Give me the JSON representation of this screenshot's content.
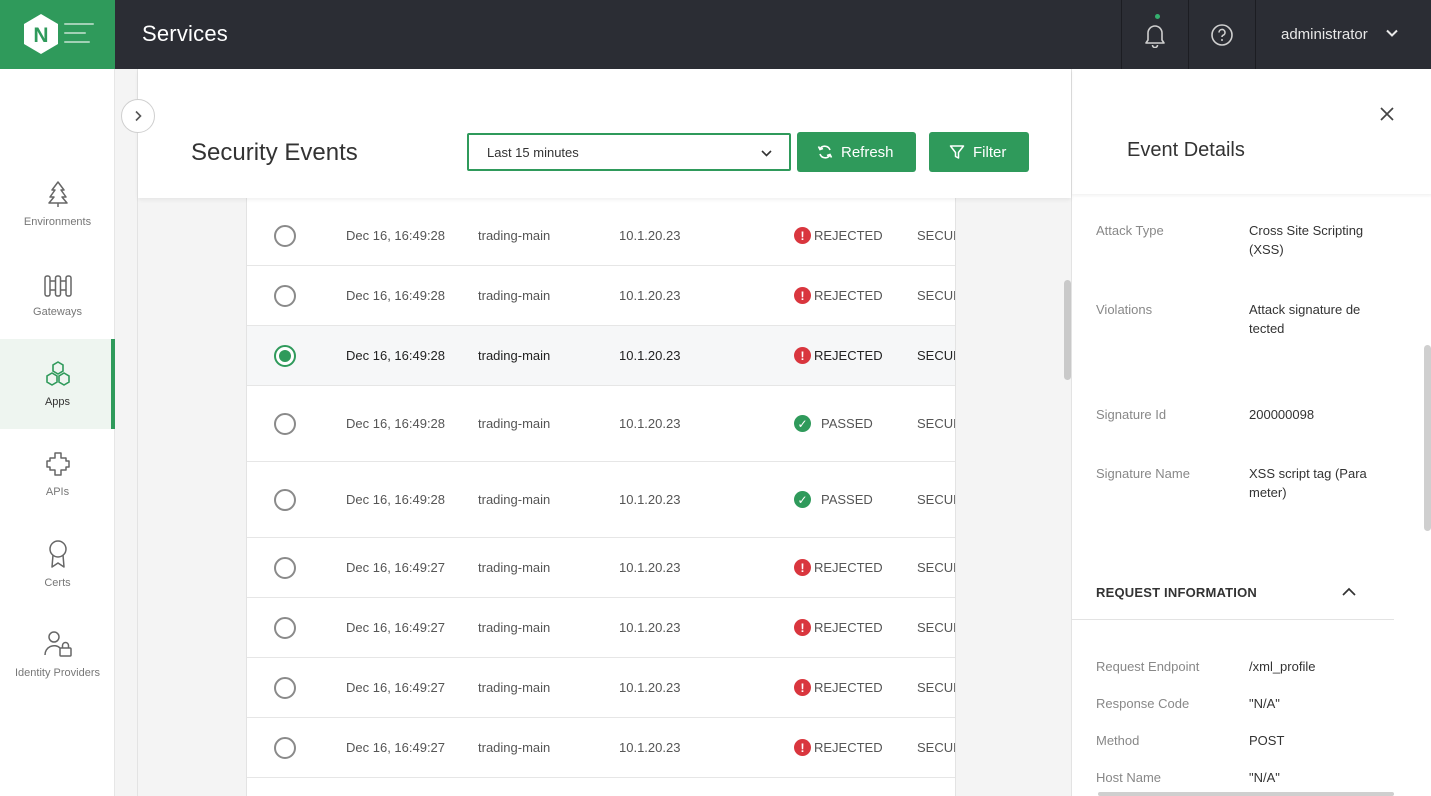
{
  "app": {
    "title": "Services",
    "logo_letter": "N",
    "user": "administrator"
  },
  "sidebar": {
    "items": [
      {
        "label": "Environments",
        "icon": "tree-icon",
        "active": false
      },
      {
        "label": "Gateways",
        "icon": "gateway-icon",
        "active": false
      },
      {
        "label": "Apps",
        "icon": "apps-hexagons-icon",
        "active": true
      },
      {
        "label": "APIs",
        "icon": "api-puzzle-icon",
        "active": false
      },
      {
        "label": "Certs",
        "icon": "certificate-ribbon-icon",
        "active": false
      },
      {
        "label": "Identity Providers",
        "icon": "identity-user-lock-icon",
        "active": false
      }
    ]
  },
  "main": {
    "title": "Security Events",
    "time_range": "Last 15 minutes",
    "refresh_label": "Refresh",
    "filter_label": "Filter"
  },
  "events": [
    {
      "time": "Dec 16, 16:49:28",
      "env": "trading-main",
      "ip": "10.1.20.23",
      "status": "REJECTED",
      "type": "SECUR",
      "selected": false
    },
    {
      "time": "Dec 16, 16:49:28",
      "env": "trading-main",
      "ip": "10.1.20.23",
      "status": "REJECTED",
      "type": "SECUR",
      "selected": false
    },
    {
      "time": "Dec 16, 16:49:28",
      "env": "trading-main",
      "ip": "10.1.20.23",
      "status": "REJECTED",
      "type": "SECUR",
      "selected": true
    },
    {
      "time": "Dec 16, 16:49:28",
      "env": "trading-main",
      "ip": "10.1.20.23",
      "status": "PASSED",
      "type": "SECUR",
      "selected": false
    },
    {
      "time": "Dec 16, 16:49:28",
      "env": "trading-main",
      "ip": "10.1.20.23",
      "status": "PASSED",
      "type": "SECUR",
      "selected": false
    },
    {
      "time": "Dec 16, 16:49:27",
      "env": "trading-main",
      "ip": "10.1.20.23",
      "status": "REJECTED",
      "type": "SECUR",
      "selected": false
    },
    {
      "time": "Dec 16, 16:49:27",
      "env": "trading-main",
      "ip": "10.1.20.23",
      "status": "REJECTED",
      "type": "SECUR",
      "selected": false
    },
    {
      "time": "Dec 16, 16:49:27",
      "env": "trading-main",
      "ip": "10.1.20.23",
      "status": "REJECTED",
      "type": "SECUR",
      "selected": false
    },
    {
      "time": "Dec 16, 16:49:27",
      "env": "trading-main",
      "ip": "10.1.20.23",
      "status": "REJECTED",
      "type": "SECUR",
      "selected": false
    }
  ],
  "details": {
    "title": "Event Details",
    "attack_type_label": "Attack Type",
    "attack_type_value": "Cross Site Scripting (XSS)",
    "violations_label": "Violations",
    "violations_value": "Attack signature de tected",
    "signature_id_label": "Signature Id",
    "signature_id_value": "200000098",
    "signature_name_label": "Signature Name",
    "signature_name_value": "XSS script tag (Para meter)",
    "request_section": "REQUEST INFORMATION",
    "endpoint_label": "Request Endpoint",
    "endpoint_value": "/xml_profile",
    "response_code_label": "Response Code",
    "response_code_value": "\"N/A\"",
    "method_label": "Method",
    "method_value": "POST",
    "host_label": "Host Name",
    "host_value": "\"N/A\""
  },
  "colors": {
    "brand_green": "#2f9a5b",
    "topbar": "#2b2d34",
    "rejected_red": "#d9363e"
  }
}
